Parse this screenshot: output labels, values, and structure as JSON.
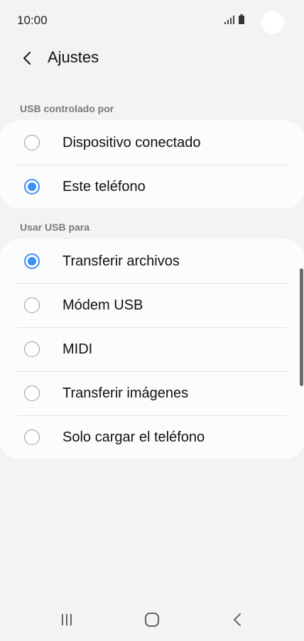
{
  "status_bar": {
    "time": "10:00"
  },
  "header": {
    "title": "Ajustes",
    "back_icon": "chevron-left-icon"
  },
  "usb_controlled_by": {
    "title": "USB controlado por",
    "options": [
      {
        "label": "Dispositivo conectado",
        "selected": false
      },
      {
        "label": "Este teléfono",
        "selected": true
      }
    ]
  },
  "use_usb_for": {
    "title": "Usar USB para",
    "options": [
      {
        "label": "Transferir archivos",
        "selected": true
      },
      {
        "label": "Módem USB",
        "selected": false
      },
      {
        "label": "MIDI",
        "selected": false
      },
      {
        "label": "Transferir imágenes",
        "selected": false
      },
      {
        "label": "Solo cargar el teléfono",
        "selected": false
      }
    ]
  },
  "nav_bar": {
    "recents_icon": "recents-icon",
    "home_icon": "home-icon",
    "back_icon": "back-icon"
  },
  "colors": {
    "accent": "#3e91f4",
    "background": "#f3f3f3",
    "card": "#fcfcfc"
  }
}
